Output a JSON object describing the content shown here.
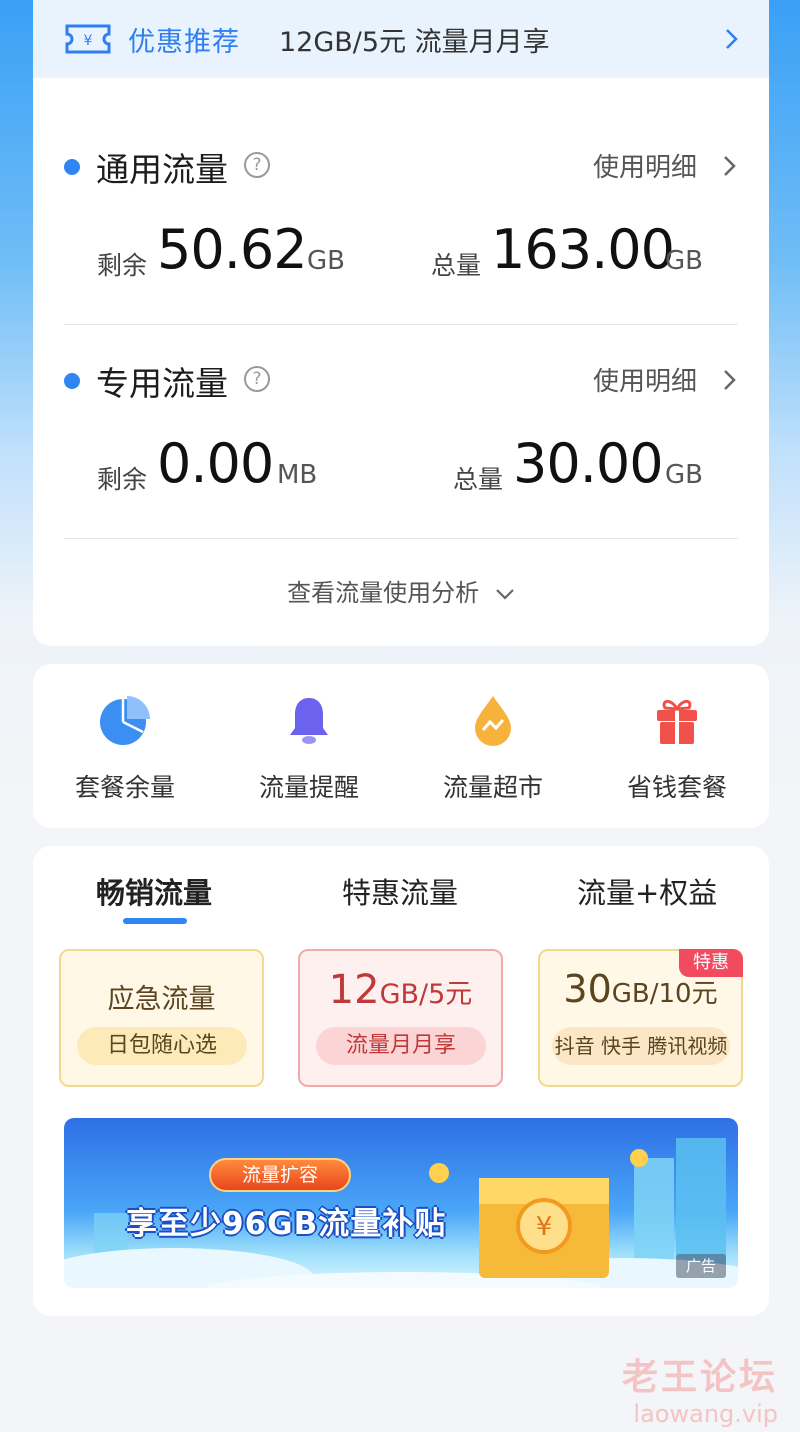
{
  "promo": {
    "title": "优惠推荐",
    "text": "12GB/5元 流量月月享"
  },
  "general": {
    "title": "通用流量",
    "detail": "使用明细",
    "remain_label": "剩余",
    "remain_value": "50.62",
    "remain_unit": "GB",
    "total_label": "总量",
    "total_value": "163.00",
    "total_unit": "GB"
  },
  "dedicated": {
    "title": "专用流量",
    "detail": "使用明细",
    "remain_label": "剩余",
    "remain_value": "0.00",
    "remain_unit": "MB",
    "total_label": "总量",
    "total_value": "30.00",
    "total_unit": "GB"
  },
  "analysis_link": "查看流量使用分析",
  "shortcuts": [
    {
      "label": "套餐余量",
      "icon": "pie-chart-icon"
    },
    {
      "label": "流量提醒",
      "icon": "bell-icon"
    },
    {
      "label": "流量超市",
      "icon": "drop-icon"
    },
    {
      "label": "省钱套餐",
      "icon": "gift-icon"
    }
  ],
  "tabs": [
    "畅销流量",
    "特惠流量",
    "流量+权益"
  ],
  "offers": [
    {
      "title": "应急流量",
      "subtitle": "日包随心选"
    },
    {
      "price_num": "12",
      "price_rest": "GB/5元",
      "subtitle": "流量月月享"
    },
    {
      "price_num": "30",
      "price_rest": "GB/10元",
      "subtitle": "抖音 快手 腾讯视频",
      "badge": "特惠"
    }
  ],
  "banner": {
    "tag": "流量扩容",
    "text": "享至少96GB流量补贴",
    "ad": "广告"
  },
  "watermark": {
    "main": "老王论坛",
    "sub": "laowang.vip"
  },
  "colors": {
    "accent": "#2f86f0",
    "promo_bg": "#e9f3fe",
    "badge": "#f24a5e"
  }
}
